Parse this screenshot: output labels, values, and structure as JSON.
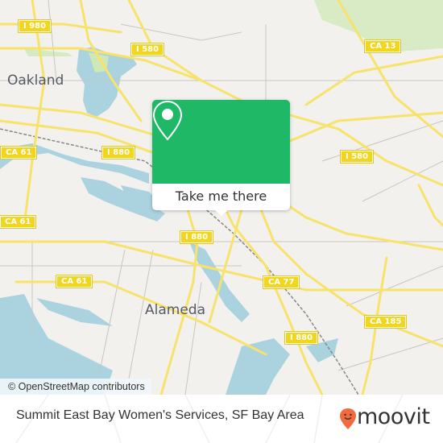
{
  "map": {
    "city_labels": [
      {
        "id": "oakland",
        "text": "Oakland"
      },
      {
        "id": "alameda",
        "text": "Alameda"
      }
    ],
    "road_shields": [
      {
        "id": "i980",
        "text": "I 980"
      },
      {
        "id": "i580-west",
        "text": "I 580"
      },
      {
        "id": "ca13",
        "text": "CA 13"
      },
      {
        "id": "i580-east",
        "text": "I 580"
      },
      {
        "id": "ca61-north",
        "text": "CA 61"
      },
      {
        "id": "i880-north",
        "text": "I 880"
      },
      {
        "id": "ca61-west",
        "text": "CA 61"
      },
      {
        "id": "i880-mid",
        "text": "I 880"
      },
      {
        "id": "ca61-south",
        "text": "CA 61"
      },
      {
        "id": "ca77",
        "text": "CA 77"
      },
      {
        "id": "ca185",
        "text": "CA 185"
      },
      {
        "id": "i880-south",
        "text": "I 880"
      }
    ],
    "attribution": "© OpenStreetMap contributors",
    "colors": {
      "water": "#aad3df",
      "road": "#f7e36b",
      "land": "#f2f1ee",
      "park": "#cfe8b5"
    }
  },
  "popup": {
    "icon": "location-pin-icon",
    "button_label": "Take me there",
    "color": "#1fb866"
  },
  "footer": {
    "title": "Summit East Bay Women's Services, SF Bay Area",
    "logo_text": "moovit",
    "logo_color": "#f26a3d"
  }
}
